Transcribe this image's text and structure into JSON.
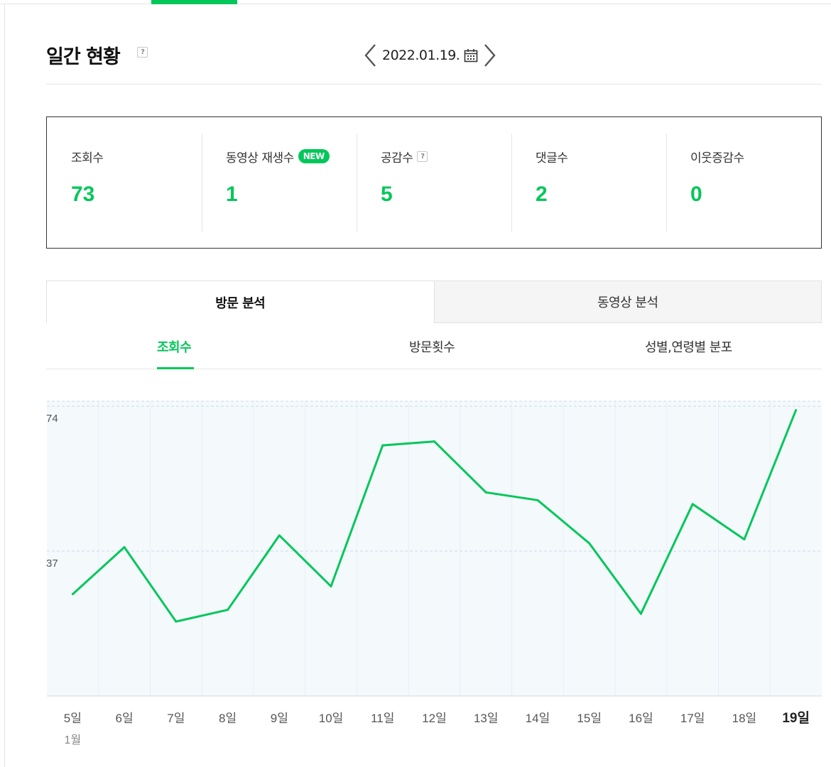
{
  "header": {
    "title": "일간 현황",
    "help_glyph": "?",
    "date": "2022.01.19.",
    "prev_icon": "chevron-left-icon",
    "next_icon": "chevron-right-icon",
    "calendar_icon": "calendar-icon"
  },
  "stats": [
    {
      "label": "조회수",
      "value": "73"
    },
    {
      "label": "동영상 재생수",
      "badge": "NEW",
      "value": "1"
    },
    {
      "label": "공감수",
      "help": "?",
      "value": "5"
    },
    {
      "label": "댓글수",
      "value": "2"
    },
    {
      "label": "이웃증감수",
      "value": "0"
    }
  ],
  "tabs": [
    {
      "label": "방문 분석",
      "active": true
    },
    {
      "label": "동영상 분석",
      "active": false
    }
  ],
  "subtabs": [
    {
      "label": "조회수",
      "active": true
    },
    {
      "label": "방문횟수",
      "active": false
    },
    {
      "label": "성별,연령별 분포",
      "active": false
    }
  ],
  "colors": {
    "accent": "#03c75a",
    "chart_bg": "#f4f9fc",
    "grid": "#d6e6f2"
  },
  "chart_data": {
    "type": "line",
    "categories": [
      "5일",
      "6일",
      "7일",
      "8일",
      "9일",
      "10일",
      "11일",
      "12일",
      "13일",
      "14일",
      "15일",
      "16일",
      "17일",
      "18일",
      "19일"
    ],
    "month_label": "1월",
    "highlight_category": "19일",
    "yticks": [
      "74",
      "37"
    ],
    "ylim": [
      0,
      74
    ],
    "grid": true,
    "series": [
      {
        "values": [
          26,
          38,
          19,
          22,
          41,
          28,
          64,
          65,
          52,
          50,
          39,
          21,
          49,
          40,
          73
        ]
      }
    ]
  }
}
